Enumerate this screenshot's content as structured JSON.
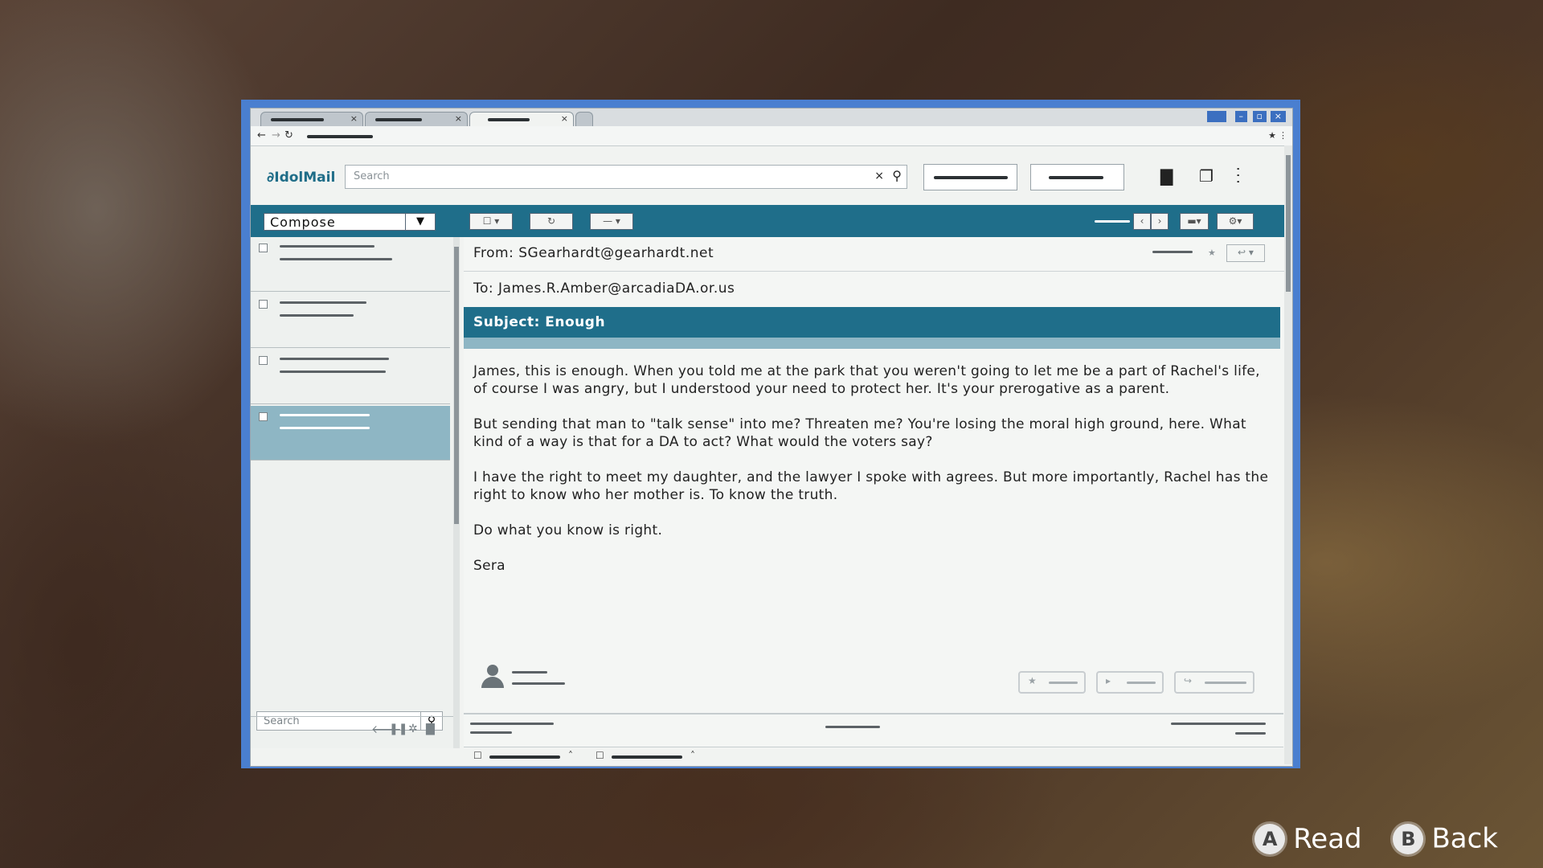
{
  "app": {
    "brand": "IdolMail",
    "search_placeholder": "Search",
    "compose_label": "Compose"
  },
  "email": {
    "from": "From: SGearhardt@gearhardt.net",
    "to": "To: James.R.Amber@arcadiaDA.or.us",
    "subject": "Subject: Enough",
    "paragraphs": [
      "James, this is enough. When you told me at the park that you weren't going to let me be a part of Rachel's life, of course I was angry, but I understood your need to protect her. It's your prerogative as a parent.",
      "But sending that man to \"talk sense\" into me? Threaten me? You're losing the moral high ground, here. What kind of a way is that for a DA to act? What would the voters say?",
      "I have the right to meet my daughter, and the lawyer I spoke with agrees. But more importantly, Rachel has the right to know who her mother is. To know the truth.",
      "Do what you know is right.",
      "Sera"
    ]
  },
  "sidebar": {
    "search_placeholder": "Search"
  },
  "prompts": {
    "a_glyph": "A",
    "a_label": "Read",
    "b_glyph": "B",
    "b_label": "Back"
  },
  "icons": {
    "close": "×",
    "search": "⚲",
    "back": "←",
    "forward": "→",
    "reload": "↻",
    "star": "★",
    "folder": "▇",
    "windows": "❐",
    "apps": "⋮⋮⋮",
    "dropdown": "▼"
  }
}
